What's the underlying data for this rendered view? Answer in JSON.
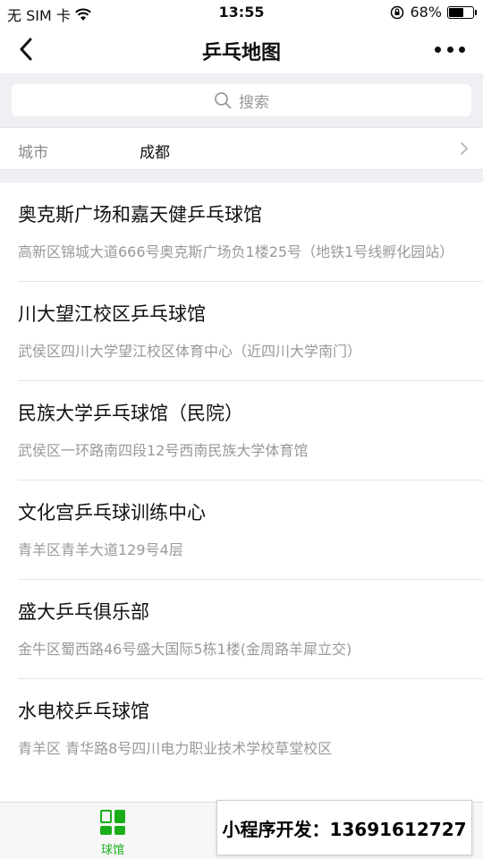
{
  "status_bar": {
    "carrier": "无 SIM 卡",
    "time": "13:55",
    "battery_percent": "68%",
    "battery_level": 0.68
  },
  "nav": {
    "title": "乒乓地图"
  },
  "search": {
    "placeholder": "搜索"
  },
  "city": {
    "label": "城市",
    "value": "成都"
  },
  "venues": [
    {
      "name": "奥克斯广场和嘉天健乒乓球馆",
      "address": "高新区锦城大道666号奥克斯广场负1楼25号（地铁1号线孵化园站）"
    },
    {
      "name": "川大望江校区乒乓球馆",
      "address": "武侯区四川大学望江校区体育中心（近四川大学南门）"
    },
    {
      "name": "民族大学乒乓球馆（民院）",
      "address": "武侯区一环路南四段12号西南民族大学体育馆"
    },
    {
      "name": "文化宫乒乓球训练中心",
      "address": "青羊区青羊大道129号4层"
    },
    {
      "name": "盛大乒乓俱乐部",
      "address": "金牛区蜀西路46号盛大国际5栋1楼(金周路羊犀立交)"
    },
    {
      "name": "水电校乒乓球馆",
      "address": "青羊区 青华路8号四川电力职业技术学校草堂校区"
    }
  ],
  "tab_bar": {
    "active_tab_label": "球馆"
  },
  "banner": {
    "text": "小程序开发：13691612727"
  },
  "colors": {
    "accent_green": "#1aad19",
    "background_gray": "#efeff4",
    "secondary_text": "#999999"
  }
}
